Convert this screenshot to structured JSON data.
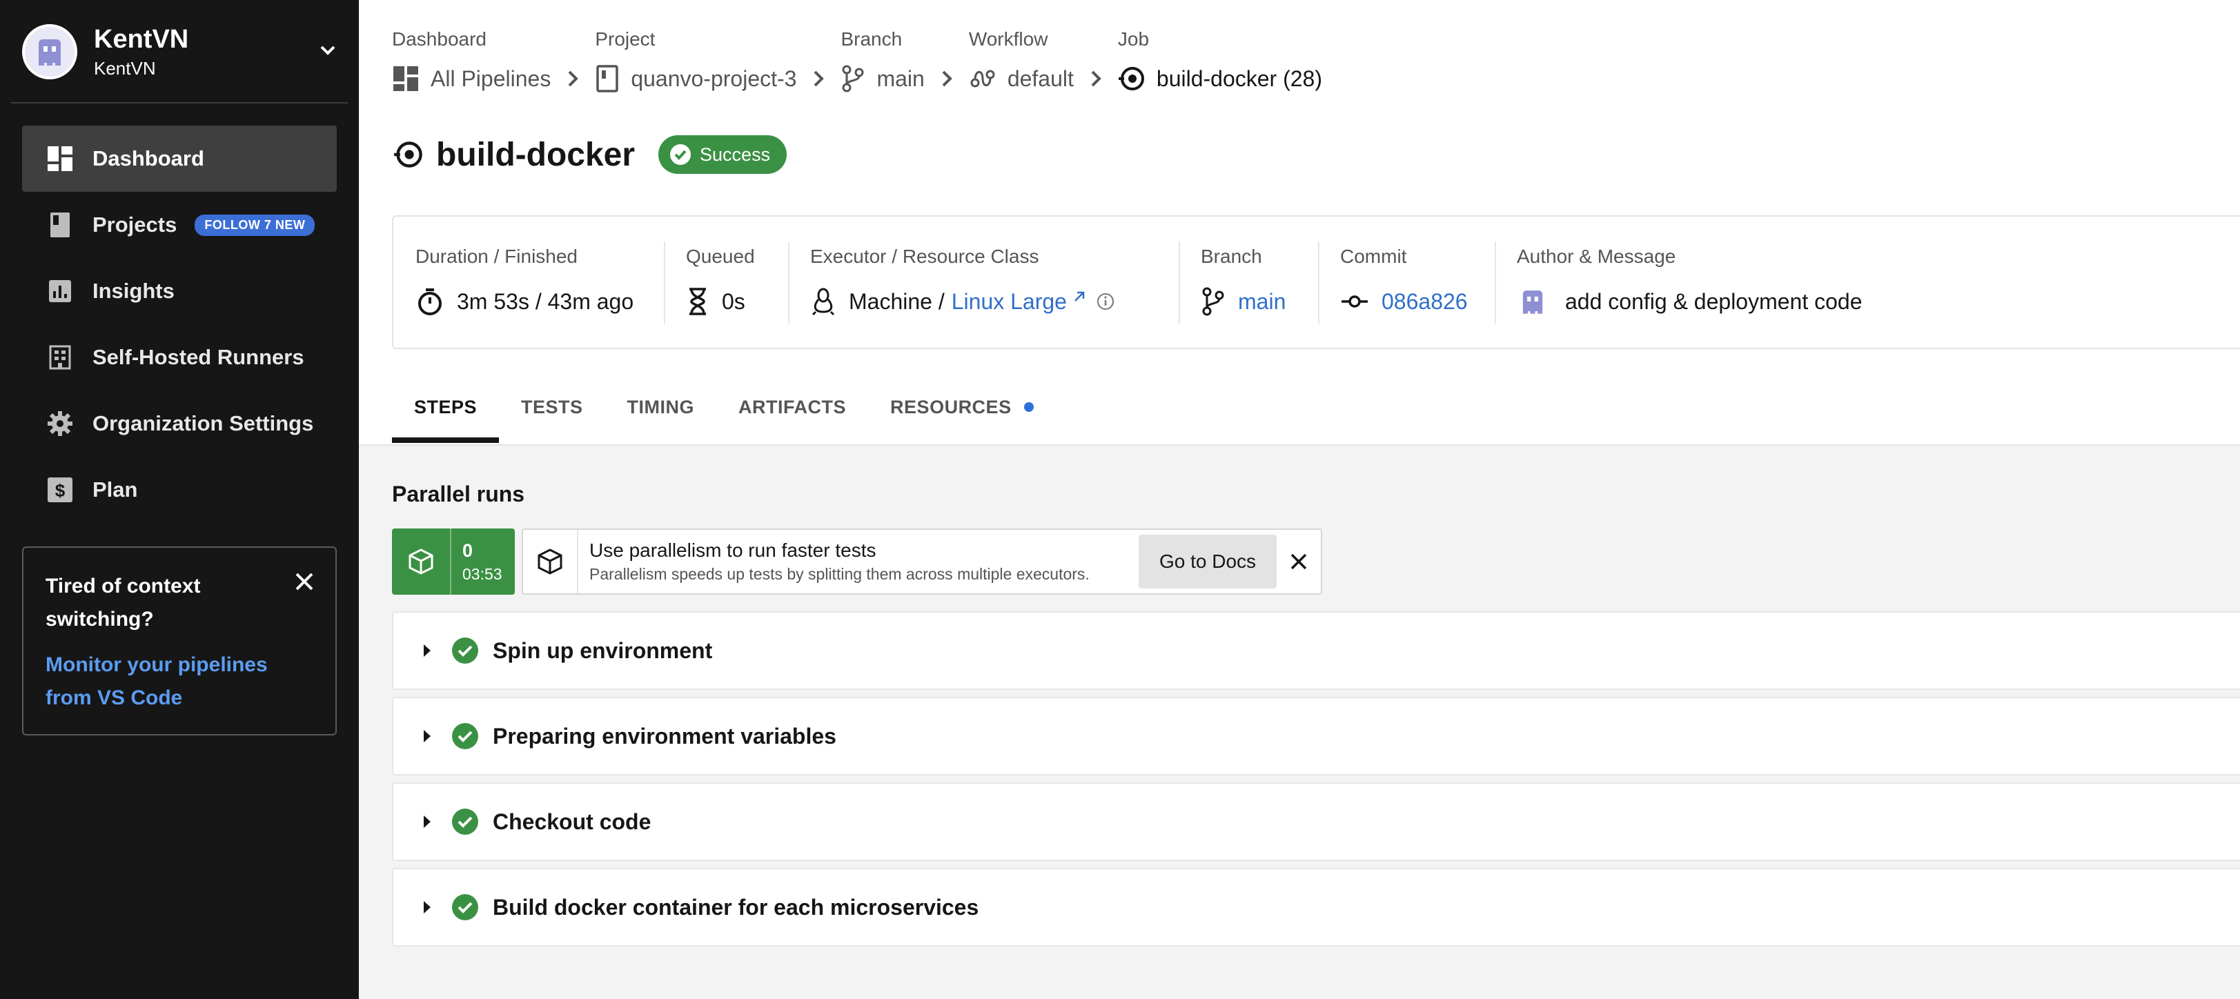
{
  "org": {
    "name": "KentVN",
    "sub": "KentVN"
  },
  "nav": [
    {
      "label": "Dashboard",
      "icon": "dashboard-icon"
    },
    {
      "label": "Projects",
      "icon": "projects-icon",
      "badge": "FOLLOW 7 NEW"
    },
    {
      "label": "Insights",
      "icon": "insights-icon"
    },
    {
      "label": "Self-Hosted Runners",
      "icon": "runners-icon"
    },
    {
      "label": "Organization Settings",
      "icon": "gear-icon"
    },
    {
      "label": "Plan",
      "icon": "dollar-icon"
    }
  ],
  "promo": {
    "title": "Tired of context switching?",
    "link": "Monitor your pipelines from VS Code"
  },
  "breadcrumb": [
    {
      "label": "Dashboard",
      "value": "All Pipelines"
    },
    {
      "label": "Project",
      "value": "quanvo-project-3"
    },
    {
      "label": "Branch",
      "value": "main"
    },
    {
      "label": "Workflow",
      "value": "default"
    },
    {
      "label": "Job",
      "value": "build-docker (28)"
    }
  ],
  "job": {
    "title": "build-docker",
    "status": "Success"
  },
  "summary": {
    "duration_label": "Duration / Finished",
    "duration_value": "3m 53s / 43m ago",
    "queued_label": "Queued",
    "queued_value": "0s",
    "executor_label": "Executor / Resource Class",
    "executor_machine": "Machine /",
    "executor_class": "Linux Large",
    "branch_label": "Branch",
    "branch_value": "main",
    "commit_label": "Commit",
    "commit_value": "086a826",
    "author_label": "Author & Message",
    "author_message": "add config & deployment code"
  },
  "tabs": [
    "STEPS",
    "TESTS",
    "TIMING",
    "ARTIFACTS",
    "RESOURCES"
  ],
  "parallel": {
    "title": "Parallel runs",
    "run_index": "0",
    "run_time": "03:53",
    "banner_title": "Use parallelism to run faster tests",
    "banner_sub": "Parallelism speeds up tests by splitting them across multiple executors.",
    "docs_button": "Go to Docs"
  },
  "steps": [
    "Spin up environment",
    "Preparing environment variables",
    "Checkout code",
    "Build docker container for each microservices"
  ],
  "colors": {
    "success": "#3b9143",
    "link": "#2f6fc9",
    "sidebar": "#161616",
    "badge": "#3b6fd6"
  }
}
